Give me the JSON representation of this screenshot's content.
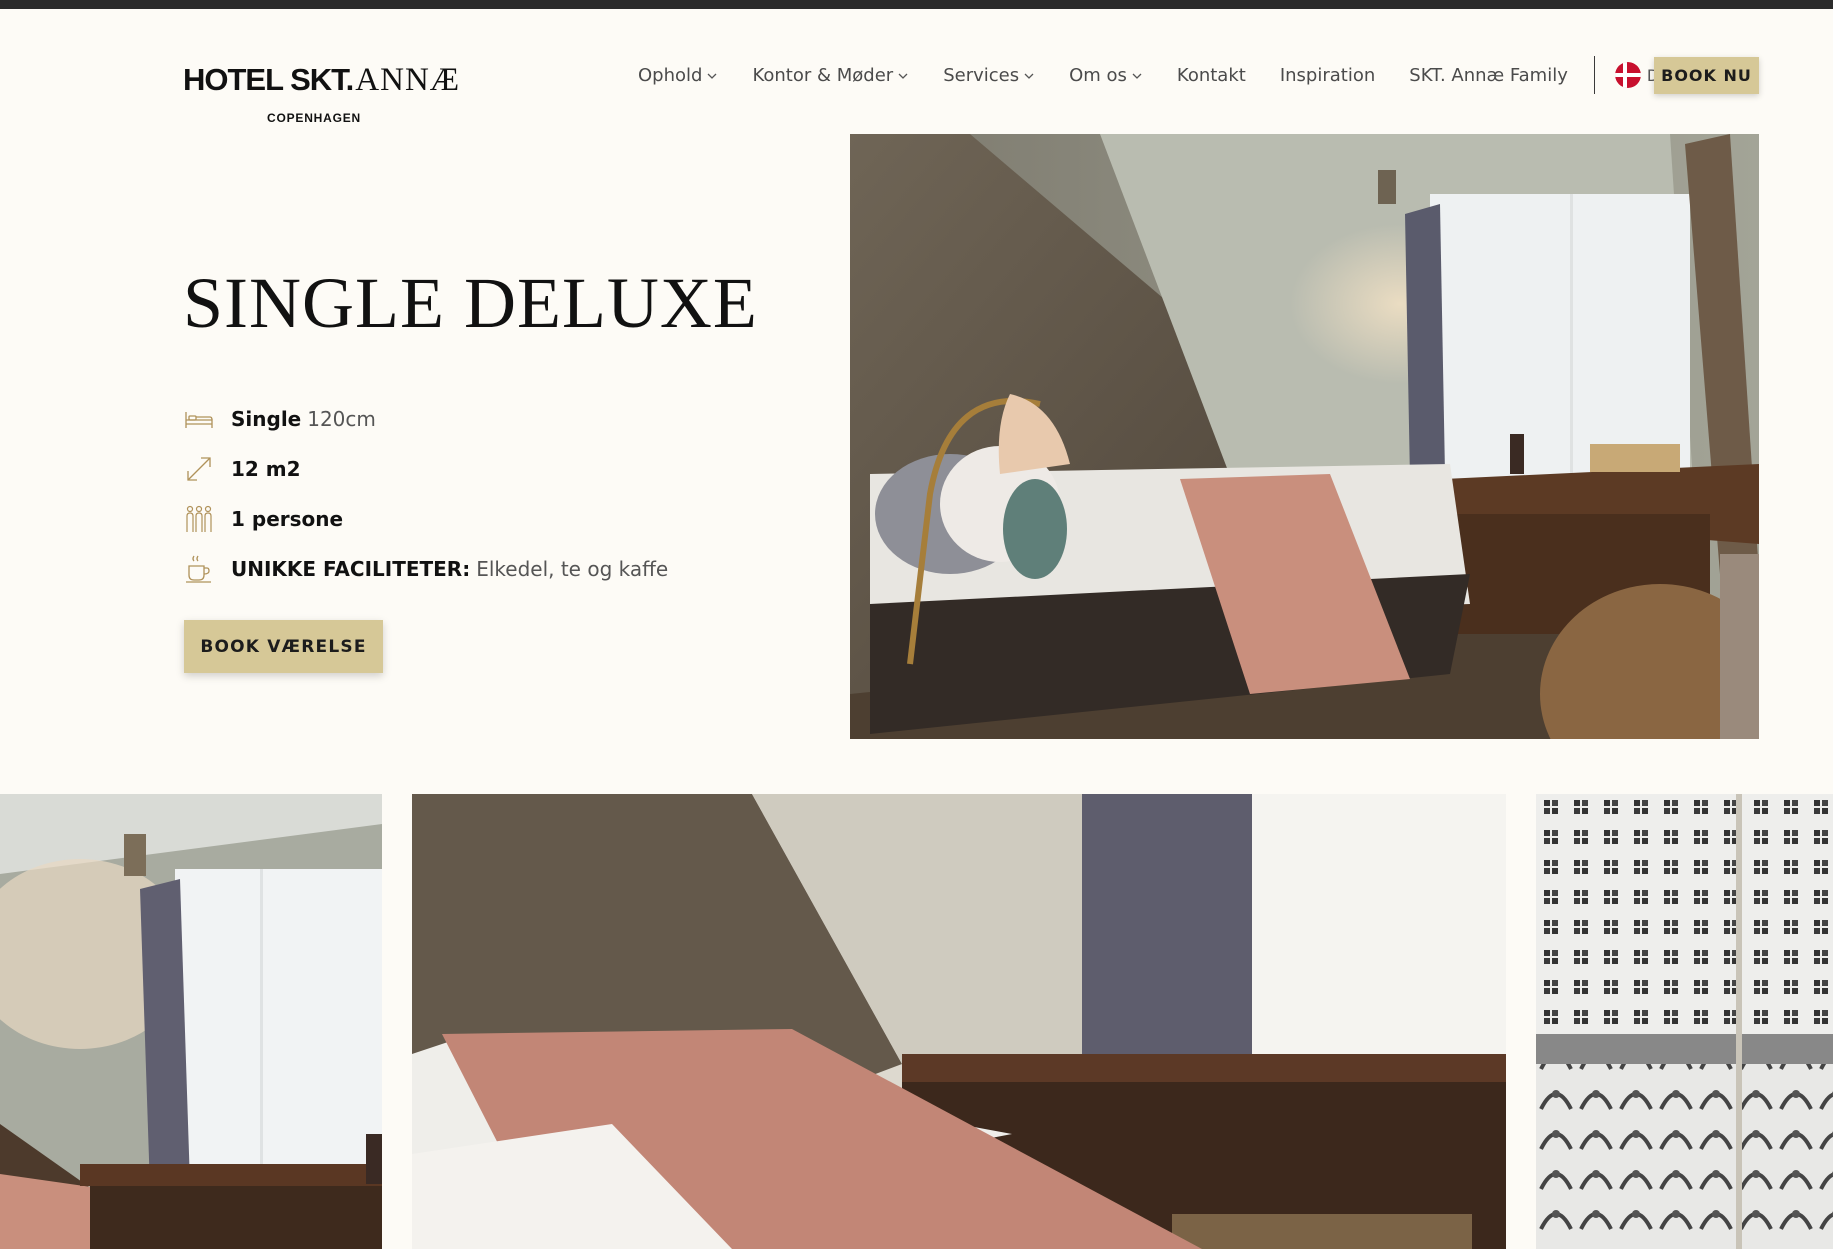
{
  "header": {
    "logo_main": "HOTEL SKT.",
    "logo_annae": "ANNÆ",
    "logo_sub": "COPENHAGEN",
    "nav": [
      {
        "label": "Ophold",
        "dropdown": true
      },
      {
        "label": "Kontor & Møder",
        "dropdown": true
      },
      {
        "label": "Services",
        "dropdown": true
      },
      {
        "label": "Om os",
        "dropdown": true
      },
      {
        "label": "Kontakt",
        "dropdown": false
      },
      {
        "label": "Inspiration",
        "dropdown": false
      },
      {
        "label": "SKT. Annæ Family",
        "dropdown": false
      }
    ],
    "language": "DA",
    "book_button": "BOOK NU"
  },
  "room": {
    "title": "SINGLE DELUXE",
    "features": {
      "bed_label": "Single",
      "bed_size": "120cm",
      "area": "12 m2",
      "guests": "1 persone",
      "facilities_label": "UNIKKE FACILITETER:",
      "facilities_value": "Elkedel, te og kaffe"
    },
    "book_button": "BOOK VÆRELSE"
  },
  "colors": {
    "background": "#fdfbf6",
    "accent_button": "#d6c897",
    "icon_gold": "#b0925a",
    "topbar": "#2b2b2b"
  },
  "icons": [
    "chevron-down-icon",
    "denmark-flag-icon",
    "bed-icon",
    "area-arrow-icon",
    "people-icon",
    "kettle-cup-icon"
  ]
}
